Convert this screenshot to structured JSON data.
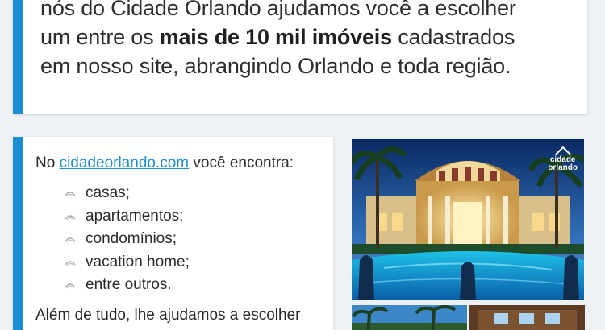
{
  "intro": {
    "line1": "nós do Cidade Orlando ajudamos você a escolher",
    "line2_before": "um entre os ",
    "line2_bold": "mais de 10 mil imóveis",
    "line2_after": " cadastrados",
    "line3": "em nosso site, abrangindo Orlando e toda região."
  },
  "offer": {
    "lead_before": "No ",
    "link_text": "cidadeorlando.com",
    "lead_after": " você encontra:",
    "items": [
      "casas;",
      "apartamentos;",
      "condomínios;",
      "vacation home;",
      "entre outros."
    ],
    "closing": "Além de tudo, lhe ajudamos a escolher"
  },
  "brand": {
    "line1": "cidade",
    "line2": "orlando"
  },
  "icons": {
    "bullet": "arc-bullet-icon",
    "brand_mark": "roof-icon"
  },
  "colors": {
    "accent": "#1a8ed0",
    "background": "#eef1f4",
    "card": "#ffffff"
  }
}
